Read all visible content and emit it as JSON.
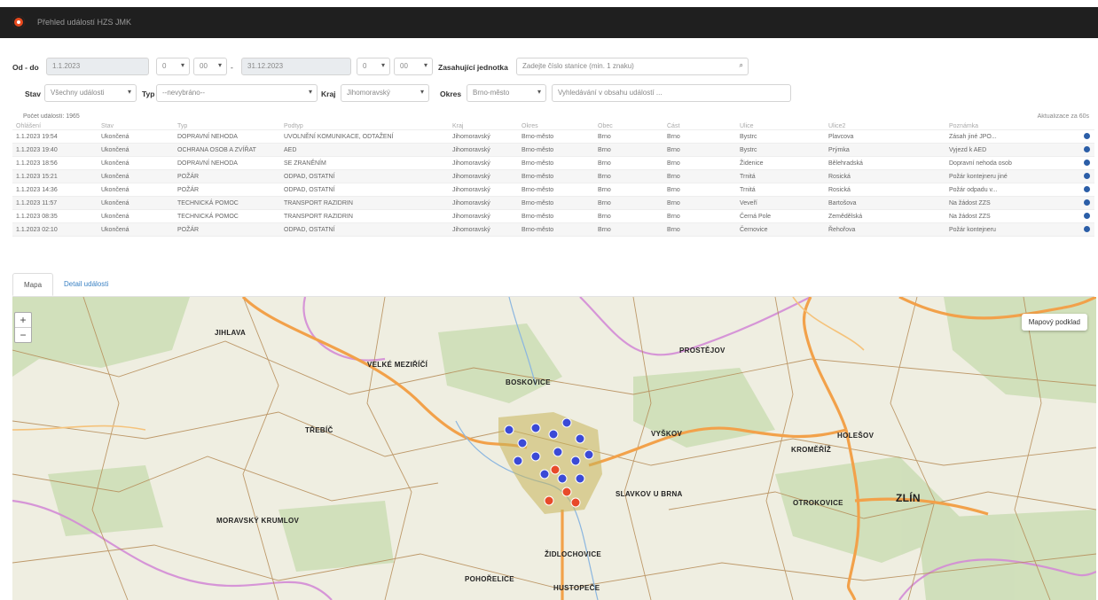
{
  "app": {
    "title": "Přehled událostí HZS JMK"
  },
  "filters": {
    "date_label": "Od - do",
    "date_from": "1.1.2023",
    "hour_from": "0",
    "min_from": "00",
    "dash": "-",
    "date_to": "31.12.2023",
    "hour_to": "0",
    "min_to": "00",
    "unit_label": "Zasahující jednotka",
    "unit_placeholder": "Zadejte číslo stanice (min. 1 znaku)",
    "stav_label": "Stav",
    "stav_value": "Všechny události",
    "typ_label": "Typ",
    "typ_value": "--nevybráno--",
    "kraj_label": "Kraj",
    "kraj_value": "Jihomoravský",
    "okres_label": "Okres",
    "okres_value": "Brno-město",
    "search_placeholder": "Vyhledávání v obsahu událostí ..."
  },
  "table": {
    "count_label": "Počet událostí: 1965",
    "scroll_hint": "Aktualizace za 60s",
    "headers": [
      "Ohlášení",
      "Stav",
      "Typ",
      "Podtyp",
      "Kraj",
      "Okres",
      "Obec",
      "Část",
      "Ulice",
      "Ulice2",
      "Poznámka",
      ""
    ],
    "rows": [
      [
        "1.1.2023 19:54",
        "Ukončená",
        "DOPRAVNÍ NEHODA",
        "UVOLNĚNÍ KOMUNIKACE, ODTAŽENÍ",
        "Jihomoravský",
        "Brno-město",
        "Brno",
        "Brno",
        "Bystrc",
        "Plavcova",
        "Zásah jiné JPO..."
      ],
      [
        "1.1.2023 19:40",
        "Ukončená",
        "OCHRANA OSOB A ZVÍŘAT",
        "AED",
        "Jihomoravský",
        "Brno-město",
        "Brno",
        "Brno",
        "Bystrc",
        "Prýmka",
        "Vyjezd k AED"
      ],
      [
        "1.1.2023 18:56",
        "Ukončená",
        "DOPRAVNÍ NEHODA",
        "SE ZRANĚNÍM",
        "Jihomoravský",
        "Brno-město",
        "Brno",
        "Brno",
        "Židenice",
        "Bělehradská",
        "Dopravní nehoda osob"
      ],
      [
        "1.1.2023 15:21",
        "Ukončená",
        "POŽÁR",
        "ODPAD, OSTATNÍ",
        "Jihomoravský",
        "Brno-město",
        "Brno",
        "Brno",
        "Trnitá",
        "Rosická",
        "Požár kontejneru jiné"
      ],
      [
        "1.1.2023 14:36",
        "Ukončená",
        "POŽÁR",
        "ODPAD, OSTATNÍ",
        "Jihomoravský",
        "Brno-město",
        "Brno",
        "Brno",
        "Trnitá",
        "Rosická",
        "Požár odpadu v..."
      ],
      [
        "1.1.2023 11:57",
        "Ukončená",
        "TECHNICKÁ POMOC",
        "TRANSPORT RAZIDRIN",
        "Jihomoravský",
        "Brno-město",
        "Brno",
        "Brno",
        "Veveří",
        "Bartošova",
        "Na žádost ZZS"
      ],
      [
        "1.1.2023 08:35",
        "Ukončená",
        "TECHNICKÁ POMOC",
        "TRANSPORT RAZIDRIN",
        "Jihomoravský",
        "Brno-město",
        "Brno",
        "Brno",
        "Černá Pole",
        "Zemědělská",
        "Na žádost ZZS"
      ],
      [
        "1.1.2023 02:10",
        "Ukončená",
        "POŽÁR",
        "ODPAD, OSTATNÍ",
        "Jihomoravský",
        "Brno-město",
        "Brno",
        "Brno",
        "Černovice",
        "Řehořova",
        "Požár kontejneru"
      ]
    ]
  },
  "tabs": {
    "map": "Mapa",
    "detail": "Detail události"
  },
  "map": {
    "zoom_in": "+",
    "zoom_out": "−",
    "layer_button": "Mapový podklad",
    "cities": [
      "JIHLAVA",
      "ZLÍN",
      "KROMĚŘÍŽ",
      "PROSTĚJOV",
      "VYŠKOV",
      "SLAVKOV U BRNA",
      "ŽIDLOCHOVICE",
      "BOSKOVICE",
      "VELKÉ MEZIŘÍČÍ",
      "TŘEBÍČ",
      "POHOŘELICE",
      "MORAVSKÝ KRUMLOV",
      "HUSTOPEČE",
      "OTROKOVICE",
      "HOLEŠOV"
    ]
  }
}
